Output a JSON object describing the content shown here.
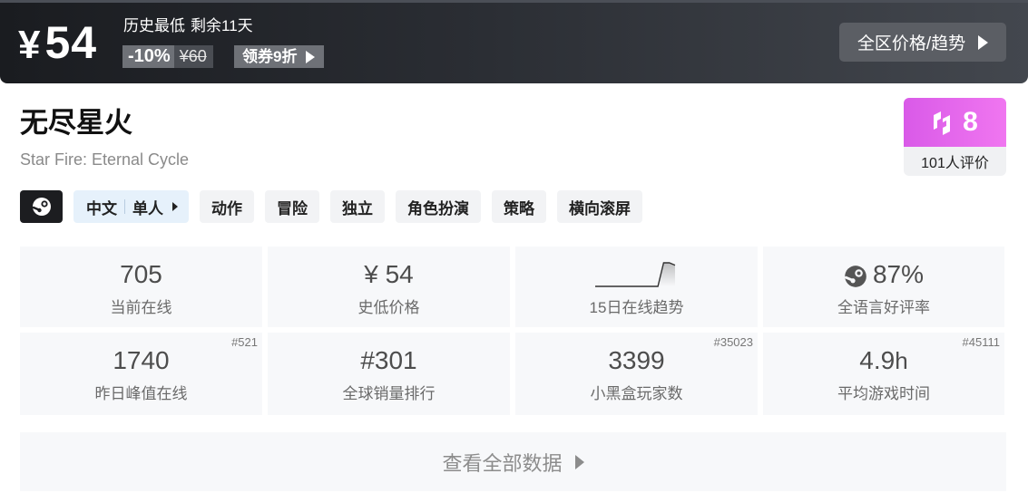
{
  "banner": {
    "currency": "¥",
    "price": "54",
    "history_low": "历史最低",
    "remaining": "剩余11天",
    "discount": "-10%",
    "original_price": "¥60",
    "coupon": "领券9折",
    "trend_button": "全区价格/趋势"
  },
  "game": {
    "title": "无尽星火",
    "subtitle": "Star Fire: Eternal Cycle",
    "score": "8",
    "reviews": "101人评价",
    "score_color": "#e066ec"
  },
  "tags": {
    "platform_icon": "steam-icon",
    "language": "中文",
    "mode": "单人",
    "items": [
      "动作",
      "冒险",
      "独立",
      "角色扮演",
      "策略",
      "横向滚屏"
    ]
  },
  "stats": {
    "current_online": {
      "value": "705",
      "label": "当前在线"
    },
    "lowest_price": {
      "value": "¥ 54",
      "label": "史低价格"
    },
    "trend": {
      "label": "15日在线趋势",
      "values": [
        0,
        0,
        0,
        0,
        0,
        0,
        0,
        0,
        0,
        0,
        0,
        0,
        1,
        1,
        0.9
      ]
    },
    "positive_rate": {
      "value": "87%",
      "label": "全语言好评率"
    },
    "peak_yesterday": {
      "value": "1740",
      "label": "昨日峰值在线",
      "rank": "#521"
    },
    "global_sales": {
      "value": "#301",
      "label": "全球销量排行"
    },
    "heybox_players": {
      "value": "3399",
      "label": "小黑盒玩家数",
      "rank": "#35023"
    },
    "avg_playtime": {
      "value": "4.9",
      "unit": "h",
      "label": "平均游戏时间",
      "rank": "#45111"
    }
  },
  "footer": {
    "view_all": "查看全部数据"
  }
}
